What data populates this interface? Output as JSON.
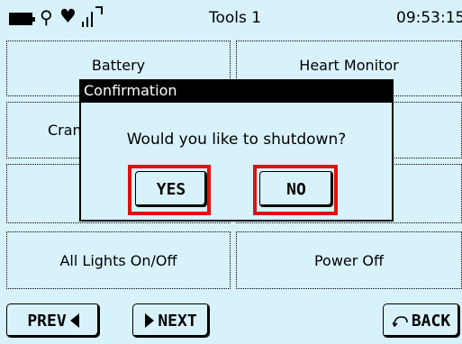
{
  "status_bar": {
    "title": "Tools 1",
    "clock": "09:53:15",
    "icons": [
      "battery-icon",
      "bulb-icon",
      "heart-icon",
      "signal-icon"
    ]
  },
  "tiles": {
    "battery": "Battery",
    "heart_monitor": "Heart Monitor",
    "crank": "Cran",
    "all_lights": "All Lights On/Off",
    "power_off": "Power Off"
  },
  "nav": {
    "prev": "PREV",
    "next": "NEXT",
    "back": "BACK"
  },
  "dialog": {
    "title": "Confirmation",
    "message": "Would you like to shutdown?",
    "yes": "YES",
    "no": "NO"
  },
  "colors": {
    "background": "#d8f2fb",
    "highlight": "#e01010"
  }
}
